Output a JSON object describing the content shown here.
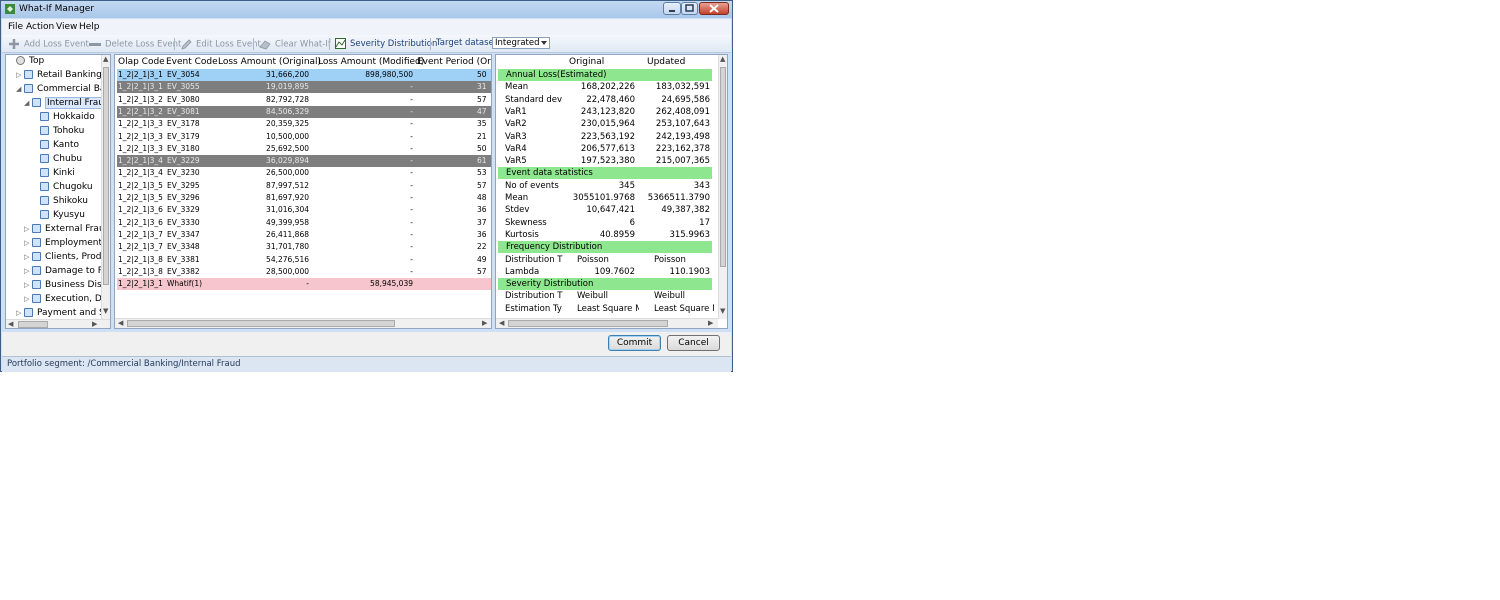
{
  "window": {
    "title": "What-If Manager"
  },
  "menu": [
    "File",
    "Action",
    "View",
    "Help"
  ],
  "toolbar": {
    "add_loss_event": "Add Loss Event",
    "delete_loss_event": "Delete Loss Event",
    "edit_loss_event": "Edit Loss Event",
    "clear_whatif": "Clear What-If",
    "severity_distribution": "Severity Distribution",
    "target_label": "Target dataset:",
    "target_value": "Integrated"
  },
  "tree": [
    {
      "label": "Top"
    },
    {
      "label": "Retail Banking"
    },
    {
      "label": "Commercial Ban"
    },
    {
      "label": "Internal Fraud"
    },
    {
      "label": "Hokkaido"
    },
    {
      "label": "Tohoku"
    },
    {
      "label": "Kanto"
    },
    {
      "label": "Chubu"
    },
    {
      "label": "Kinki"
    },
    {
      "label": "Chugoku"
    },
    {
      "label": "Shikoku"
    },
    {
      "label": "Kyusyu"
    },
    {
      "label": "External Fraud"
    },
    {
      "label": "Employment P"
    },
    {
      "label": "Clients, Produ"
    },
    {
      "label": "Damage to Ph"
    },
    {
      "label": "Business Disru"
    },
    {
      "label": "Execution, Deli"
    },
    {
      "label": "Payment and Set"
    }
  ],
  "grid": {
    "headers": [
      "Olap Code",
      "Event Code",
      "Loss Amount (Original)",
      "Loss Amount (Modified)",
      "Event Period (Origi"
    ],
    "rows": [
      {
        "olap": "1_2|2_1|3_1",
        "event": "EV_3054",
        "orig": "31,666,200",
        "mod": "898,980,500",
        "period": "50",
        "state": "sel"
      },
      {
        "olap": "1_2|2_1|3_1",
        "event": "EV_3055",
        "orig": "19,019,895",
        "mod": "-",
        "period": "31",
        "state": "del"
      },
      {
        "olap": "1_2|2_1|3_2",
        "event": "EV_3080",
        "orig": "82,792,728",
        "mod": "-",
        "period": "57",
        "state": ""
      },
      {
        "olap": "1_2|2_1|3_2",
        "event": "EV_3081",
        "orig": "84,506,329",
        "mod": "-",
        "period": "47",
        "state": "del"
      },
      {
        "olap": "1_2|2_1|3_3",
        "event": "EV_3178",
        "orig": "20,359,325",
        "mod": "-",
        "period": "35",
        "state": ""
      },
      {
        "olap": "1_2|2_1|3_3",
        "event": "EV_3179",
        "orig": "10,500,000",
        "mod": "-",
        "period": "21",
        "state": ""
      },
      {
        "olap": "1_2|2_1|3_3",
        "event": "EV_3180",
        "orig": "25,692,500",
        "mod": "-",
        "period": "50",
        "state": ""
      },
      {
        "olap": "1_2|2_1|3_4",
        "event": "EV_3229",
        "orig": "36,029,894",
        "mod": "-",
        "period": "61",
        "state": "del"
      },
      {
        "olap": "1_2|2_1|3_4",
        "event": "EV_3230",
        "orig": "26,500,000",
        "mod": "-",
        "period": "53",
        "state": ""
      },
      {
        "olap": "1_2|2_1|3_5",
        "event": "EV_3295",
        "orig": "87,997,512",
        "mod": "-",
        "period": "57",
        "state": ""
      },
      {
        "olap": "1_2|2_1|3_5",
        "event": "EV_3296",
        "orig": "81,697,920",
        "mod": "-",
        "period": "48",
        "state": ""
      },
      {
        "olap": "1_2|2_1|3_6",
        "event": "EV_3329",
        "orig": "31,016,304",
        "mod": "-",
        "period": "36",
        "state": ""
      },
      {
        "olap": "1_2|2_1|3_6",
        "event": "EV_3330",
        "orig": "49,399,958",
        "mod": "-",
        "period": "37",
        "state": ""
      },
      {
        "olap": "1_2|2_1|3_7",
        "event": "EV_3347",
        "orig": "26,411,868",
        "mod": "-",
        "period": "36",
        "state": ""
      },
      {
        "olap": "1_2|2_1|3_7",
        "event": "EV_3348",
        "orig": "31,701,780",
        "mod": "-",
        "period": "22",
        "state": ""
      },
      {
        "olap": "1_2|2_1|3_8",
        "event": "EV_3381",
        "orig": "54,276,516",
        "mod": "-",
        "period": "49",
        "state": ""
      },
      {
        "olap": "1_2|2_1|3_8",
        "event": "EV_3382",
        "orig": "28,500,000",
        "mod": "-",
        "period": "57",
        "state": ""
      },
      {
        "olap": "1_2|2_1|3_1",
        "event": "Whatif(1)",
        "orig": "-",
        "mod": "58,945,039",
        "period": "",
        "state": "whatif"
      }
    ]
  },
  "stats": {
    "headers": [
      "Original",
      "Updated"
    ],
    "rows": [
      {
        "type": "section",
        "label": "Annual Loss(Estimated)"
      },
      {
        "label": "Mean",
        "orig": "168,202,226",
        "upd": "183,032,591",
        "align": "num"
      },
      {
        "label": "Standard dev",
        "orig": "22,478,460",
        "upd": "24,695,586",
        "align": "num"
      },
      {
        "label": "VaR1",
        "orig": "243,123,820",
        "upd": "262,408,091",
        "align": "num"
      },
      {
        "label": "VaR2",
        "orig": "230,015,964",
        "upd": "253,107,643",
        "align": "num"
      },
      {
        "label": "VaR3",
        "orig": "223,563,192",
        "upd": "242,193,498",
        "align": "num"
      },
      {
        "label": "VaR4",
        "orig": "206,577,613",
        "upd": "223,162,378",
        "align": "num"
      },
      {
        "label": "VaR5",
        "orig": "197,523,380",
        "upd": "215,007,365",
        "align": "num"
      },
      {
        "type": "section",
        "label": "Event data statistics"
      },
      {
        "label": "No of events",
        "orig": "345",
        "upd": "343",
        "align": "num"
      },
      {
        "label": "Mean",
        "orig": "3055101.9768",
        "upd": "5366511.3790",
        "align": "num"
      },
      {
        "label": "Stdev",
        "orig": "10,647,421",
        "upd": "49,387,382",
        "align": "num"
      },
      {
        "label": "Skewness",
        "orig": "6",
        "upd": "17",
        "align": "num"
      },
      {
        "label": "Kurtosis",
        "orig": "40.8959",
        "upd": "315.9963",
        "align": "num"
      },
      {
        "type": "section",
        "label": "Frequency Distribution"
      },
      {
        "label": "Distribution T",
        "orig": "Poisson",
        "upd": "Poisson",
        "align": "text"
      },
      {
        "label": "Lambda",
        "orig": "109.7602",
        "upd": "110.1903",
        "align": "num"
      },
      {
        "type": "section",
        "label": "Severity Distribution"
      },
      {
        "label": "Distribution T",
        "orig": "Weibull",
        "upd": "Weibull",
        "align": "text"
      },
      {
        "label": "Estimation Ty",
        "orig": "Least Square M",
        "upd": "Least Square M",
        "align": "text"
      }
    ]
  },
  "buttons": {
    "commit": "Commit",
    "cancel": "Cancel"
  },
  "status": "Portfolio segment: /Commercial Banking/Internal Fraud"
}
